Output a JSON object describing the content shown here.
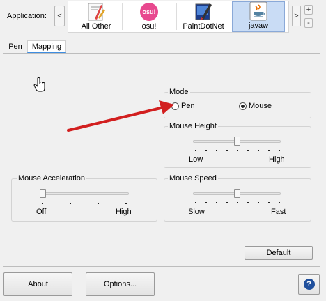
{
  "toolbar": {
    "application_label": "Application:",
    "scroll_left": "<",
    "scroll_right": ">",
    "add": "+",
    "remove": "-",
    "apps": [
      {
        "label": "All Other",
        "icon": "all-other-app-icon"
      },
      {
        "label": "osu!",
        "icon": "osu-app-icon",
        "icon_text": "osu!"
      },
      {
        "label": "PaintDotNet",
        "icon": "paintdotnet-app-icon"
      },
      {
        "label": "javaw",
        "icon": "java-app-icon",
        "selected": true
      }
    ]
  },
  "tabs": [
    {
      "label": "Pen",
      "active": false
    },
    {
      "label": "Mapping",
      "active": true
    }
  ],
  "mode": {
    "title": "Mode",
    "options": [
      {
        "label": "Pen",
        "selected": false
      },
      {
        "label": "Mouse",
        "selected": true
      }
    ]
  },
  "mouse_height": {
    "title": "Mouse Height",
    "min_label": "Low",
    "max_label": "High",
    "level": 0.5
  },
  "mouse_acceleration": {
    "title": "Mouse Acceleration",
    "min_label": "Off",
    "max_label": "High",
    "level": 0.0
  },
  "mouse_speed": {
    "title": "Mouse Speed",
    "min_label": "Slow",
    "max_label": "Fast",
    "level": 0.5
  },
  "buttons": {
    "default": "Default",
    "about": "About",
    "options": "Options...",
    "help": "?"
  },
  "colors": {
    "arrow": "#d21f1f",
    "selected_tab_underline": "#3e8de0",
    "selected_app_bg": "#c9dcf5",
    "help_button": "#1f4f9c"
  }
}
